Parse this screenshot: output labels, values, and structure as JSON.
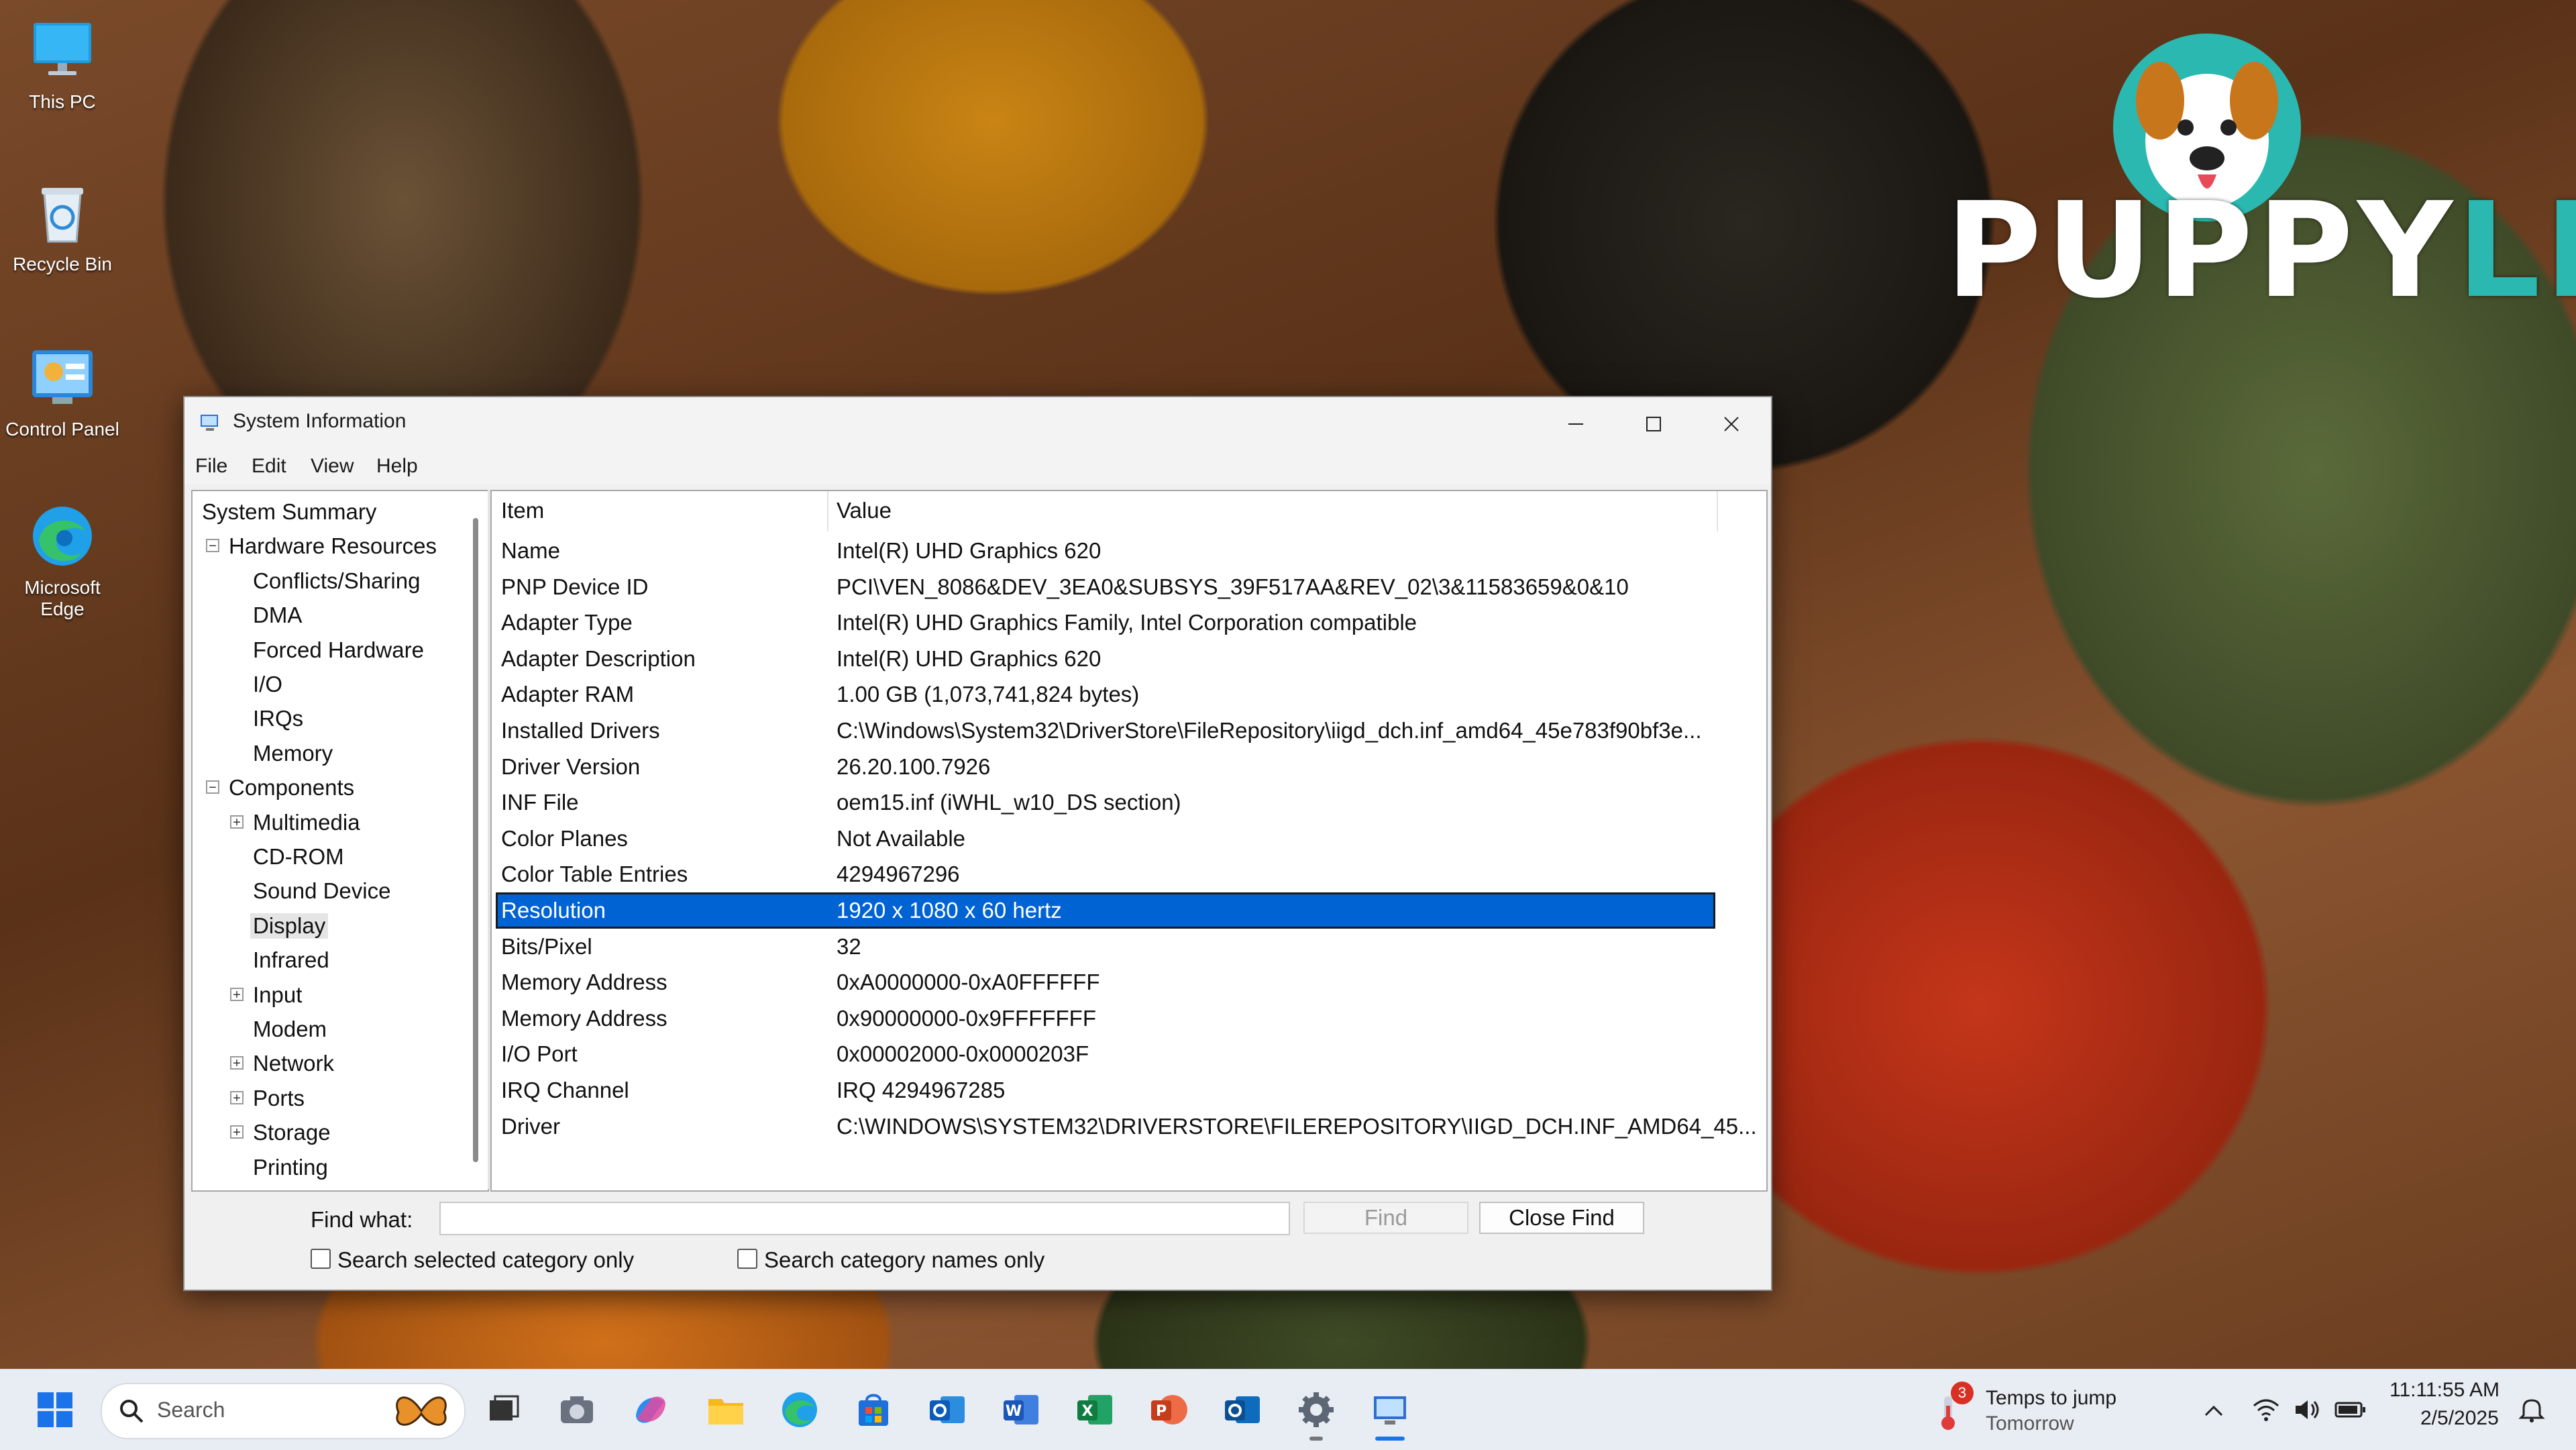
{
  "desktop": {
    "icons": [
      {
        "label": "This PC",
        "icon": "monitor-icon"
      },
      {
        "label": "Recycle Bin",
        "icon": "recycle-bin-icon"
      },
      {
        "label": "Control Panel",
        "icon": "control-panel-icon"
      },
      {
        "label": "Microsoft Edge",
        "icon": "edge-icon"
      }
    ],
    "brand": {
      "part1": "PUPP",
      "part2": "Y",
      "part3": "LIST"
    }
  },
  "window": {
    "title": "System Information",
    "menu": [
      "File",
      "Edit",
      "View",
      "Help"
    ],
    "tree": {
      "items": [
        {
          "label": "System Summary",
          "level": 0,
          "expander": ""
        },
        {
          "label": "Hardware Resources",
          "level": 1,
          "expander": "minus"
        },
        {
          "label": "Conflicts/Sharing",
          "level": 2,
          "expander": ""
        },
        {
          "label": "DMA",
          "level": 2,
          "expander": ""
        },
        {
          "label": "Forced Hardware",
          "level": 2,
          "expander": ""
        },
        {
          "label": "I/O",
          "level": 2,
          "expander": ""
        },
        {
          "label": "IRQs",
          "level": 2,
          "expander": ""
        },
        {
          "label": "Memory",
          "level": 2,
          "expander": ""
        },
        {
          "label": "Components",
          "level": 1,
          "expander": "minus"
        },
        {
          "label": "Multimedia",
          "level": 2,
          "expander": "plus"
        },
        {
          "label": "CD-ROM",
          "level": 2,
          "expander": ""
        },
        {
          "label": "Sound Device",
          "level": 2,
          "expander": ""
        },
        {
          "label": "Display",
          "level": 2,
          "expander": "",
          "selected": true
        },
        {
          "label": "Infrared",
          "level": 2,
          "expander": ""
        },
        {
          "label": "Input",
          "level": 2,
          "expander": "plus"
        },
        {
          "label": "Modem",
          "level": 2,
          "expander": ""
        },
        {
          "label": "Network",
          "level": 2,
          "expander": "plus"
        },
        {
          "label": "Ports",
          "level": 2,
          "expander": "plus"
        },
        {
          "label": "Storage",
          "level": 2,
          "expander": "plus"
        },
        {
          "label": "Printing",
          "level": 2,
          "expander": ""
        }
      ]
    },
    "details": {
      "columns": [
        "Item",
        "Value"
      ],
      "rows": [
        {
          "item": "Name",
          "value": "Intel(R) UHD Graphics 620"
        },
        {
          "item": "PNP Device ID",
          "value": "PCI\\VEN_8086&DEV_3EA0&SUBSYS_39F517AA&REV_02\\3&11583659&0&10"
        },
        {
          "item": "Adapter Type",
          "value": "Intel(R) UHD Graphics Family, Intel Corporation compatible"
        },
        {
          "item": "Adapter Description",
          "value": "Intel(R) UHD Graphics 620"
        },
        {
          "item": "Adapter RAM",
          "value": "1.00 GB (1,073,741,824 bytes)"
        },
        {
          "item": "Installed Drivers",
          "value": "C:\\Windows\\System32\\DriverStore\\FileRepository\\iigd_dch.inf_amd64_45e783f90bf3e..."
        },
        {
          "item": "Driver Version",
          "value": "26.20.100.7926"
        },
        {
          "item": "INF File",
          "value": "oem15.inf (iWHL_w10_DS section)"
        },
        {
          "item": "Color Planes",
          "value": "Not Available"
        },
        {
          "item": "Color Table Entries",
          "value": "4294967296"
        },
        {
          "item": "Resolution",
          "value": "1920 x 1080 x 60 hertz",
          "selected": true
        },
        {
          "item": "Bits/Pixel",
          "value": "32"
        },
        {
          "item": "Memory Address",
          "value": "0xA0000000-0xA0FFFFFF"
        },
        {
          "item": "Memory Address",
          "value": "0x90000000-0x9FFFFFFF"
        },
        {
          "item": "I/O Port",
          "value": "0x00002000-0x0000203F"
        },
        {
          "item": "IRQ Channel",
          "value": "IRQ 4294967285"
        },
        {
          "item": "Driver",
          "value": "C:\\WINDOWS\\SYSTEM32\\DRIVERSTORE\\FILEREPOSITORY\\IIGD_DCH.INF_AMD64_45..."
        }
      ]
    },
    "find": {
      "label": "Find what:",
      "value": "",
      "find_button": "Find",
      "close_button": "Close Find",
      "check_selected": "Search selected category only",
      "check_names": "Search category names only"
    }
  },
  "taskbar": {
    "search_placeholder": "Search",
    "apps": [
      "start-icon",
      "task-view-icon",
      "camera-icon",
      "copilot-icon",
      "file-explorer-icon",
      "edge-icon",
      "store-icon",
      "outlook-icon",
      "word-icon",
      "excel-icon",
      "powerpoint-icon",
      "outlook-classic-icon",
      "settings-icon",
      "system-information-icon"
    ],
    "weather": {
      "badge": "3",
      "title": "Temps to jump",
      "subtitle": "Tomorrow"
    },
    "clock": {
      "time": "11:11:55 AM",
      "date": "2/5/2025"
    }
  }
}
